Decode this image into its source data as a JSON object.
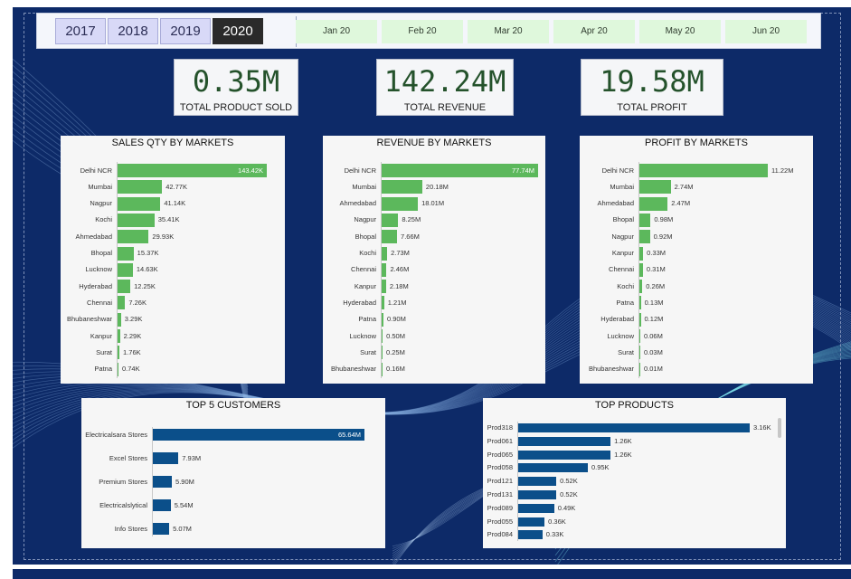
{
  "colors": {
    "background": "#0d2a68",
    "bar_green": "#5cb85c",
    "bar_blue": "#0b4f8a",
    "kpi_value": "#24522b",
    "year_selected": "#2a2a2a",
    "year_unselected": "#d8d9f7",
    "month_bg": "#dff8dc"
  },
  "filters": {
    "years": [
      {
        "label": "2017",
        "selected": false
      },
      {
        "label": "2018",
        "selected": false
      },
      {
        "label": "2019",
        "selected": false
      },
      {
        "label": "2020",
        "selected": true
      }
    ],
    "months": [
      "Jan 20",
      "Feb 20",
      "Mar 20",
      "Apr 20",
      "May 20",
      "Jun 20"
    ]
  },
  "kpis": [
    {
      "value": "0.35M",
      "label": "TOTAL PRODUCT SOLD"
    },
    {
      "value": "142.24M",
      "label": "TOTAL REVENUE"
    },
    {
      "value": "19.58M",
      "label": "TOTAL PROFIT"
    }
  ],
  "chart_data": [
    {
      "type": "bar",
      "orientation": "horizontal",
      "title": "SALES QTY BY MARKETS",
      "categories": [
        "Delhi NCR",
        "Mumbai",
        "Nagpur",
        "Kochi",
        "Ahmedabad",
        "Bhopal",
        "Lucknow",
        "Hyderabad",
        "Chennai",
        "Bhubaneshwar",
        "Kanpur",
        "Surat",
        "Patna"
      ],
      "values": [
        143.42,
        42.77,
        41.14,
        35.41,
        29.93,
        15.37,
        14.63,
        12.25,
        7.26,
        3.29,
        2.29,
        1.76,
        0.74
      ],
      "labels": [
        "143.42K",
        "42.77K",
        "41.14K",
        "35.41K",
        "29.93K",
        "15.37K",
        "14.63K",
        "12.25K",
        "7.26K",
        "3.29K",
        "2.29K",
        "1.76K",
        "0.74K"
      ],
      "unit": "K",
      "color": "#5cb85c"
    },
    {
      "type": "bar",
      "orientation": "horizontal",
      "title": "REVENUE BY MARKETS",
      "categories": [
        "Delhi NCR",
        "Mumbai",
        "Ahmedabad",
        "Nagpur",
        "Bhopal",
        "Kochi",
        "Chennai",
        "Kanpur",
        "Hyderabad",
        "Patna",
        "Lucknow",
        "Surat",
        "Bhubaneshwar"
      ],
      "values": [
        77.74,
        20.18,
        18.01,
        8.25,
        7.66,
        2.73,
        2.46,
        2.18,
        1.21,
        0.9,
        0.5,
        0.25,
        0.16
      ],
      "labels": [
        "77.74M",
        "20.18M",
        "18.01M",
        "8.25M",
        "7.66M",
        "2.73M",
        "2.46M",
        "2.18M",
        "1.21M",
        "0.90M",
        "0.50M",
        "0.25M",
        "0.16M"
      ],
      "unit": "M",
      "color": "#5cb85c"
    },
    {
      "type": "bar",
      "orientation": "horizontal",
      "title": "PROFIT BY MARKETS",
      "categories": [
        "Delhi NCR",
        "Mumbai",
        "Ahmedabad",
        "Bhopal",
        "Nagpur",
        "Kanpur",
        "Chennai",
        "Kochi",
        "Patna",
        "Hyderabad",
        "Lucknow",
        "Surat",
        "Bhubaneshwar"
      ],
      "values": [
        11.22,
        2.74,
        2.47,
        0.98,
        0.92,
        0.33,
        0.31,
        0.26,
        0.13,
        0.12,
        0.06,
        0.03,
        0.01
      ],
      "labels": [
        "11.22M",
        "2.74M",
        "2.47M",
        "0.98M",
        "0.92M",
        "0.33M",
        "0.31M",
        "0.26M",
        "0.13M",
        "0.12M",
        "0.06M",
        "0.03M",
        "0.01M"
      ],
      "unit": "M",
      "color": "#5cb85c"
    },
    {
      "type": "bar",
      "orientation": "horizontal",
      "title": "TOP 5 CUSTOMERS",
      "categories": [
        "Electricalsara Stores",
        "Excel Stores",
        "Premium Stores",
        "Electricalslytical",
        "Info Stores"
      ],
      "values": [
        65.64,
        7.93,
        5.9,
        5.54,
        5.07
      ],
      "labels": [
        "65.64M",
        "7.93M",
        "5.90M",
        "5.54M",
        "5.07M"
      ],
      "unit": "M",
      "color": "#0b4f8a"
    },
    {
      "type": "bar",
      "orientation": "horizontal",
      "title": "TOP PRODUCTS",
      "categories": [
        "Prod318",
        "Prod061",
        "Prod065",
        "Prod058",
        "Prod121",
        "Prod131",
        "Prod089",
        "Prod055",
        "Prod084"
      ],
      "values": [
        3.16,
        1.26,
        1.26,
        0.95,
        0.52,
        0.52,
        0.49,
        0.36,
        0.33
      ],
      "labels": [
        "3.16K",
        "1.26K",
        "1.26K",
        "0.95K",
        "0.52K",
        "0.52K",
        "0.49K",
        "0.36K",
        "0.33K"
      ],
      "unit": "K",
      "color": "#0b4f8a"
    }
  ]
}
